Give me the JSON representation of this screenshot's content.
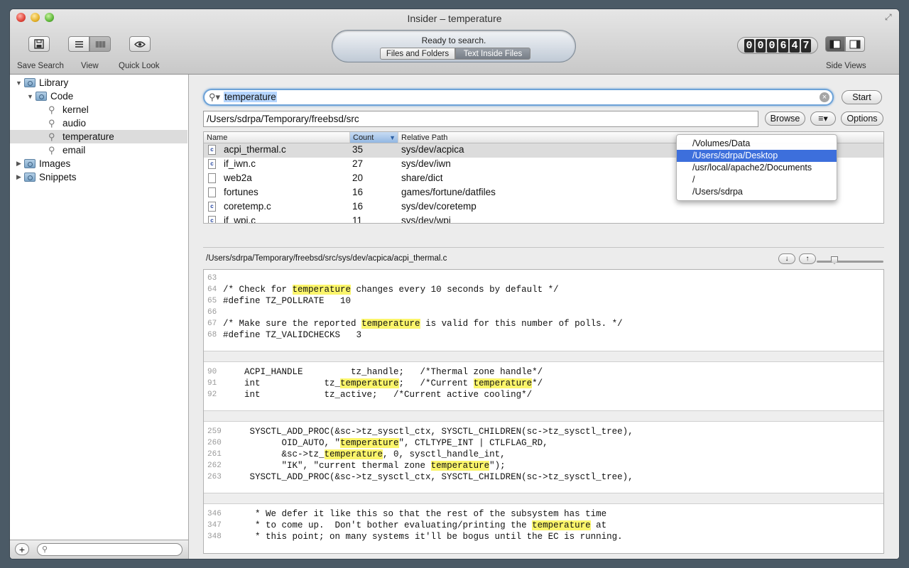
{
  "window": {
    "title": "Insider – temperature",
    "fullscreen_icon": "expand-icon"
  },
  "toolbar": {
    "save_search_label": "Save Search",
    "view_label": "View",
    "quick_look_label": "Quick Look",
    "side_views_label": "Side Views",
    "status": "Ready to search.",
    "scope_files": "Files and Folders",
    "scope_text": "Text Inside Files",
    "counter_digits": [
      "0",
      "0",
      "0",
      "6",
      "4",
      "7"
    ]
  },
  "sidebar": {
    "items": [
      {
        "label": "Library"
      },
      {
        "label": "Code"
      },
      {
        "label": "kernel"
      },
      {
        "label": "audio"
      },
      {
        "label": "temperature"
      },
      {
        "label": "email"
      },
      {
        "label": "Images"
      },
      {
        "label": "Snippets"
      }
    ],
    "add_label": "+",
    "search_placeholder": ""
  },
  "search": {
    "query": "temperature",
    "start_label": "Start",
    "path": "/Users/sdrpa/Temporary/freebsd/src",
    "browse_label": "Browse",
    "options_label": "Options"
  },
  "results": {
    "headers": {
      "name": "Name",
      "count": "Count",
      "path": "Relative Path"
    },
    "rows": [
      {
        "name": "acpi_thermal.c",
        "count": "35",
        "path": "sys/dev/acpica",
        "icon": "c"
      },
      {
        "name": "if_iwn.c",
        "count": "27",
        "path": "sys/dev/iwn",
        "icon": "c"
      },
      {
        "name": "web2a",
        "count": "20",
        "path": "share/dict",
        "icon": ""
      },
      {
        "name": "fortunes",
        "count": "16",
        "path": "games/fortune/datfiles",
        "icon": ""
      },
      {
        "name": "coretemp.c",
        "count": "16",
        "path": "sys/dev/coretemp",
        "icon": "c"
      },
      {
        "name": "if_wpi.c",
        "count": "11",
        "path": "sys/dev/wpi",
        "icon": "c"
      }
    ]
  },
  "path_menu": {
    "items": [
      "/Volumes/Data",
      "/Users/sdrpa/Desktop",
      "/usr/local/apache2/Documents",
      "/",
      "/Users/sdrpa"
    ],
    "selected_index": 1
  },
  "preview": {
    "file_path": "/Users/sdrpa/Temporary/freebsd/src/sys/dev/acpica/acpi_thermal.c",
    "down_label": "↓",
    "up_label": "↑",
    "chunks": [
      {
        "lines": [
          {
            "n": "63",
            "t": ""
          },
          {
            "n": "64",
            "t": "/* Check for [temperature] changes every 10 seconds by default */"
          },
          {
            "n": "65",
            "t": "#define TZ_POLLRATE   10"
          },
          {
            "n": "66",
            "t": ""
          },
          {
            "n": "67",
            "t": "/* Make sure the reported [temperature] is valid for this number of polls. */"
          },
          {
            "n": "68",
            "t": "#define TZ_VALIDCHECKS   3"
          }
        ]
      },
      {
        "lines": [
          {
            "n": "90",
            "t": "    ACPI_HANDLE         tz_handle;   /*Thermal zone handle*/"
          },
          {
            "n": "91",
            "t": "    int            tz_[temperature];   /*Current [temperature]*/"
          },
          {
            "n": "92",
            "t": "    int            tz_active;   /*Current active cooling*/"
          }
        ]
      },
      {
        "lines": [
          {
            "n": "259",
            "t": "     SYSCTL_ADD_PROC(&sc->tz_sysctl_ctx, SYSCTL_CHILDREN(sc->tz_sysctl_tree),"
          },
          {
            "n": "260",
            "t": "           OID_AUTO, \"[temperature]\", CTLTYPE_INT | CTLFLAG_RD,"
          },
          {
            "n": "261",
            "t": "           &sc->tz_[temperature], 0, sysctl_handle_int,"
          },
          {
            "n": "262",
            "t": "           \"IK\", \"current thermal zone [temperature]\");"
          },
          {
            "n": "263",
            "t": "     SYSCTL_ADD_PROC(&sc->tz_sysctl_ctx, SYSCTL_CHILDREN(sc->tz_sysctl_tree),"
          }
        ]
      },
      {
        "lines": [
          {
            "n": "346",
            "t": "      * We defer it like this so that the rest of the subsystem has time"
          },
          {
            "n": "347",
            "t": "      * to come up.  Don't bother evaluating/printing the [temperature] at"
          },
          {
            "n": "348",
            "t": "      * this point; on many systems it'll be bogus until the EC is running."
          }
        ]
      }
    ]
  },
  "colors": {
    "highlight": "#fbf56b",
    "selection": "#3d6fdc",
    "focus_ring": "#6ea3d8"
  }
}
